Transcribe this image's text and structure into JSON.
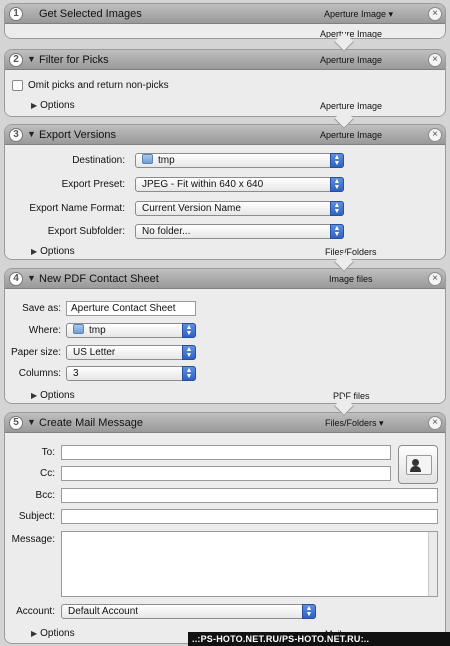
{
  "actions": [
    {
      "num": "1",
      "title": "Get Selected Images",
      "header_io": "Aperture Image ▾",
      "bottom_io": "Aperture Image"
    },
    {
      "num": "2",
      "title": "Filter for Picks",
      "header_io": "Aperture Image",
      "checkbox_label": "Omit picks and return non-picks",
      "options_label": "Options",
      "bottom_io": "Aperture Image"
    },
    {
      "num": "3",
      "title": "Export Versions",
      "header_io": "Aperture Image",
      "fields": {
        "destination_label": "Destination:",
        "destination_value": "tmp",
        "preset_label": "Export Preset:",
        "preset_value": "JPEG - Fit within 640 x 640",
        "nameformat_label": "Export Name Format:",
        "nameformat_value": "Current Version Name",
        "subfolder_label": "Export Subfolder:",
        "subfolder_value": "No folder..."
      },
      "options_label": "Options",
      "bottom_io": "Files/Folders"
    },
    {
      "num": "4",
      "title": "New PDF Contact Sheet",
      "header_io": "Image files",
      "fields": {
        "saveas_label": "Save as:",
        "saveas_value": "Aperture Contact Sheet",
        "where_label": "Where:",
        "where_value": "tmp",
        "papersize_label": "Paper size:",
        "papersize_value": "US Letter",
        "columns_label": "Columns:",
        "columns_value": "3"
      },
      "options_label": "Options",
      "bottom_io": "PDF files"
    },
    {
      "num": "5",
      "title": "Create Mail Message",
      "header_io": "Files/Folders ▾",
      "fields": {
        "to_label": "To:",
        "cc_label": "Cc:",
        "bcc_label": "Bcc:",
        "subject_label": "Subject:",
        "message_label": "Message:",
        "account_label": "Account:",
        "account_value": "Default Account"
      },
      "options_label": "Options",
      "bottom_io": "Mail message"
    }
  ],
  "icons": {
    "close": "close-icon",
    "disclosure": "disclosure-triangle-icon",
    "popup_arrow": "popup-arrow-icon",
    "folder": "folder-icon",
    "contact": "address-book-icon"
  },
  "watermark": "..:PS-HOTO.NET.RU/PS-HOTO.NET.RU:.."
}
